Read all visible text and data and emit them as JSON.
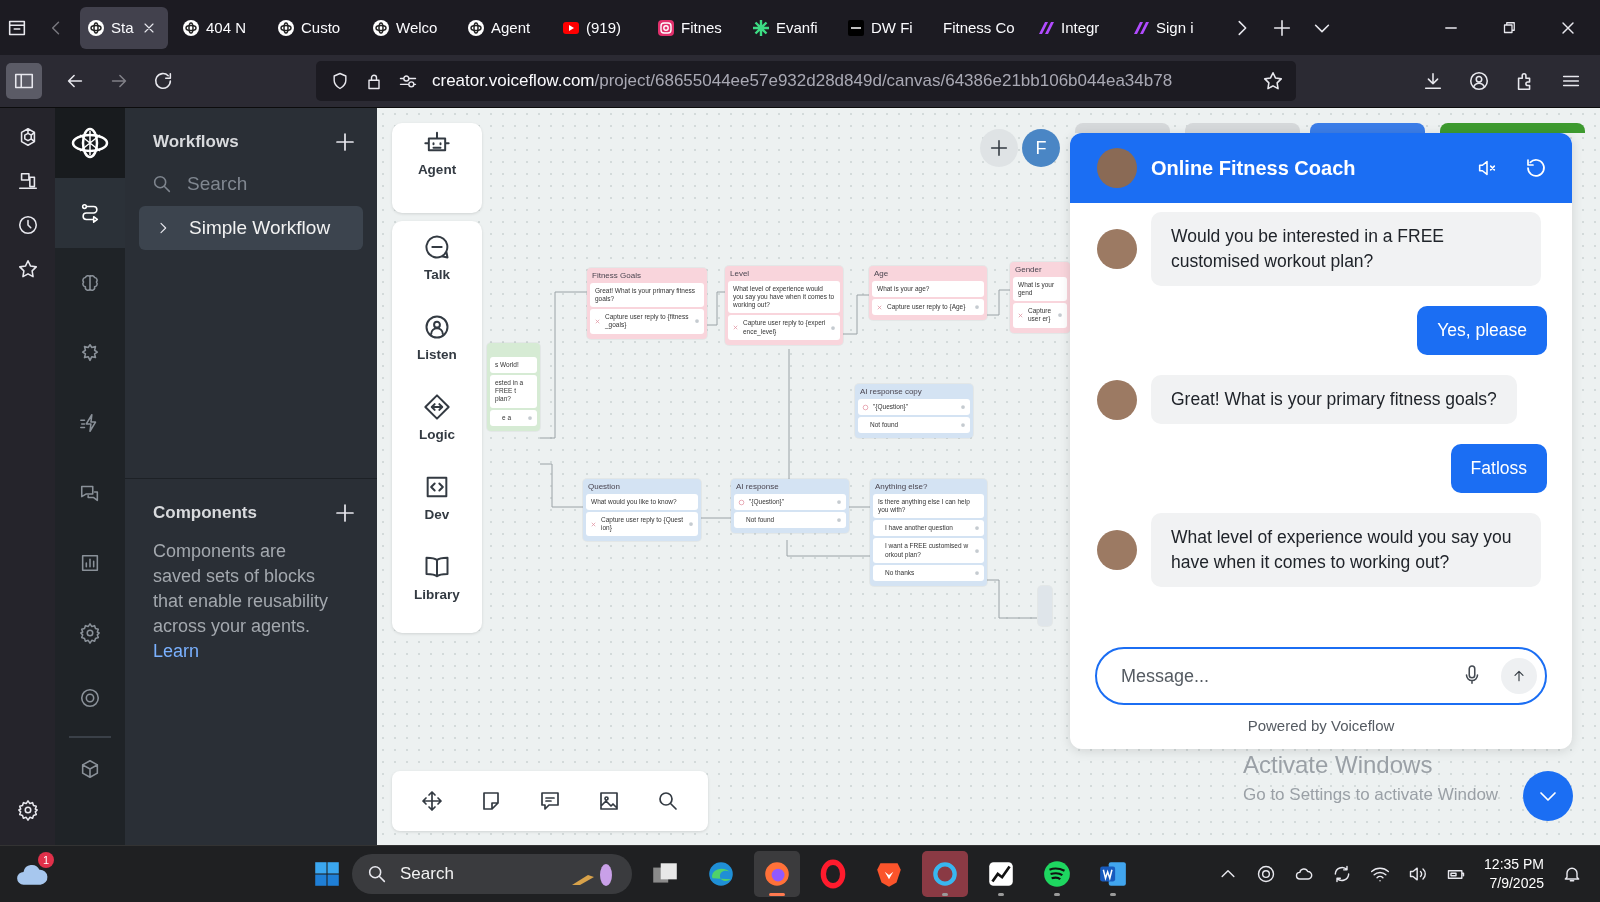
{
  "browser": {
    "tabs": [
      {
        "label": "Sta",
        "kind": "logo",
        "selected": true
      },
      {
        "label": "404 N",
        "kind": "logo",
        "selected": false
      },
      {
        "label": "Custo",
        "kind": "logo",
        "selected": false
      },
      {
        "label": "Welco",
        "kind": "logo",
        "selected": false
      },
      {
        "label": "Agent",
        "kind": "logo",
        "selected": false
      },
      {
        "label": "(919)",
        "kind": "video",
        "selected": false
      },
      {
        "label": "Fitnes",
        "kind": "camera",
        "selected": false
      },
      {
        "label": "Evanfi",
        "kind": "spark",
        "selected": false
      },
      {
        "label": "DW Fi",
        "kind": "square",
        "selected": false
      },
      {
        "label": "Fitness Co",
        "kind": "none",
        "selected": false
      },
      {
        "label": "Integr",
        "kind": "slash",
        "selected": false
      },
      {
        "label": "Sign i",
        "kind": "slash",
        "selected": false
      }
    ],
    "sidebar_open": true,
    "url_host": "creator.voiceflow.com",
    "url_path": "/project/68655044ee57e932d28d849d/canvas/64386e21bb106b044ea34b78"
  },
  "rail": [
    {
      "kind": "workflows",
      "selected": true
    },
    {
      "kind": "knowledge",
      "selected": false
    },
    {
      "kind": "integrations",
      "selected": false
    },
    {
      "kind": "events",
      "selected": false
    },
    {
      "kind": "conversations",
      "selected": false
    },
    {
      "kind": "analytics",
      "selected": false
    },
    {
      "kind": "settings",
      "selected": false
    },
    {
      "kind": "target",
      "selected": false
    },
    {
      "kind": "cube",
      "selected": false
    }
  ],
  "panel": {
    "workflows_title": "Workflows",
    "search_placeholder": "Search",
    "workflows": [
      {
        "label": "Simple Workflow",
        "selected": true
      }
    ],
    "components_title": "Components",
    "components_text": "Components are saved sets of blocks that enable reusability across your agents.",
    "components_link": "Learn"
  },
  "steps": {
    "agent": "Agent",
    "items": [
      {
        "kind": "talk",
        "label": "Talk"
      },
      {
        "kind": "listen",
        "label": "Listen"
      },
      {
        "kind": "logic",
        "label": "Logic"
      },
      {
        "kind": "dev",
        "label": "Dev"
      },
      {
        "kind": "library",
        "label": "Library"
      }
    ]
  },
  "canvas": {
    "nodes": [
      {
        "title": "Fitness Goals",
        "color": "#f9d5dc",
        "rows": [
          {
            "kind": "message",
            "text": "Great! What is your primary fitness goals?"
          },
          {
            "kind": "capture",
            "text": "Capture user reply to {fitness_goals}"
          }
        ]
      },
      {
        "title": "Level",
        "color": "#f9d5dc",
        "rows": [
          {
            "kind": "message",
            "text": "What level of experience would you say you have when it comes to working out?"
          },
          {
            "kind": "capture",
            "text": "Capture user reply to {experience_level}"
          }
        ]
      },
      {
        "title": "Age",
        "color": "#f9d5dc",
        "rows": [
          {
            "kind": "message",
            "text": "What is your age?"
          },
          {
            "kind": "capture",
            "text": "Capture user reply to {Age}"
          }
        ]
      },
      {
        "title": "Gender",
        "color": "#f9d5dc",
        "rows": [
          {
            "kind": "message",
            "text": "What is your gend"
          },
          {
            "kind": "capture",
            "text": "Capture user er}"
          }
        ]
      },
      {
        "color": "#d6ebd4",
        "rows": [
          {
            "kind": "message",
            "text": "s World!"
          },
          {
            "kind": "message",
            "text": "ested in a FREE t plan?"
          },
          {
            "kind": "choice",
            "text": "e a"
          }
        ]
      },
      {
        "title": "AI response copy",
        "color": "#d4e3f3",
        "rows": [
          {
            "kind": "ai",
            "text": "\"{Question}\""
          },
          {
            "kind": "choice",
            "text": "Not found"
          }
        ]
      },
      {
        "title": "Question",
        "color": "#d4e3f3",
        "rows": [
          {
            "kind": "message",
            "text": "What would you like to know?"
          },
          {
            "kind": "capture",
            "text": "Capture user reply to {Question}"
          }
        ]
      },
      {
        "title": "AI response",
        "color": "#d4e3f3",
        "rows": [
          {
            "kind": "ai",
            "text": "\"{Question}\""
          },
          {
            "kind": "choice",
            "text": "Not found"
          }
        ]
      },
      {
        "title": "Anything else?",
        "color": "#d4e3f3",
        "rows": [
          {
            "kind": "message",
            "text": "Is there anything else I can help you with?"
          },
          {
            "kind": "choice",
            "text": "I have another question"
          },
          {
            "kind": "choice",
            "text": "I want a FREE customised workout plan?"
          },
          {
            "kind": "choice",
            "text": "No thanks"
          }
        ]
      }
    ],
    "user_initial": "F"
  },
  "chat": {
    "title": "Online Fitness Coach",
    "messages": [
      {
        "kind": "bot",
        "text": "Would you be interested in a FREE customised workout plan?"
      },
      {
        "kind": "user",
        "text": "Yes, please"
      },
      {
        "kind": "bot",
        "text": "Great! What is your primary fitness goals?"
      },
      {
        "kind": "user",
        "text": "Fatloss"
      },
      {
        "kind": "bot",
        "text": "What level of experience would you say you have when it comes to working out?"
      }
    ],
    "placeholder": "Message...",
    "powered_by": "Powered by Voiceflow"
  },
  "os_notice": {
    "title": "Activate Windows",
    "text": "Go to Settings to activate Window"
  },
  "taskbar": {
    "weather_badge": "1",
    "search_placeholder": "Search",
    "apps": [
      {
        "kind": "taskview",
        "running": false,
        "selected": false,
        "attention": false
      },
      {
        "kind": "edge",
        "running": false,
        "selected": false,
        "attention": false
      },
      {
        "kind": "firefox",
        "running": true,
        "selected": true,
        "attention": false
      },
      {
        "kind": "opera",
        "running": false,
        "selected": false,
        "attention": false
      },
      {
        "kind": "brave",
        "running": false,
        "selected": false,
        "attention": false
      },
      {
        "kind": "ring",
        "running": true,
        "selected": false,
        "attention": true
      },
      {
        "kind": "stocks",
        "running": true,
        "selected": false,
        "attention": false
      },
      {
        "kind": "spotify",
        "running": true,
        "selected": false,
        "attention": false
      },
      {
        "kind": "word",
        "running": true,
        "selected": false,
        "attention": false
      }
    ],
    "time": "12:35 PM",
    "date": "7/9/2025"
  }
}
